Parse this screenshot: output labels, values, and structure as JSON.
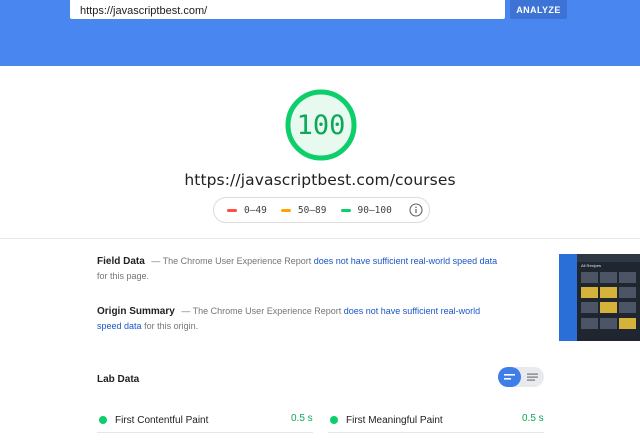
{
  "search": {
    "url_value": "https://javascriptbest.com/",
    "analyze_label": "ANALYZE"
  },
  "score": {
    "value": "100",
    "fraction": 1.0,
    "color": "#0cce6b"
  },
  "tested_url": "https://javascriptbest.com/courses",
  "legend": [
    {
      "label": "0–49",
      "color": "#ff4e42"
    },
    {
      "label": "50–89",
      "color": "#ffa400"
    },
    {
      "label": "90–100",
      "color": "#0cce6b"
    }
  ],
  "field_data": {
    "title": "Field Data",
    "prefix": "— The Chrome User Experience Report",
    "link": "does not have sufficient real-world speed data",
    "suffix": "for this page."
  },
  "origin_summary": {
    "title": "Origin Summary",
    "prefix": "— The Chrome User Experience Report",
    "link": "does not have sufficient real-world speed data",
    "suffix": "for this origin."
  },
  "thumbnail": {
    "caption": "All Recipes"
  },
  "lab_data": {
    "title": "Lab Data",
    "metrics": [
      {
        "label": "First Contentful Paint",
        "value": "0.5 s",
        "status_color": "#0cce6b"
      },
      {
        "label": "First Meaningful Paint",
        "value": "0.5 s",
        "status_color": "#0cce6b"
      }
    ]
  },
  "colors": {
    "header": "#4a86f0",
    "accent": "#3f7de8",
    "pass": "#0cce6b",
    "link": "#1a56c8"
  }
}
